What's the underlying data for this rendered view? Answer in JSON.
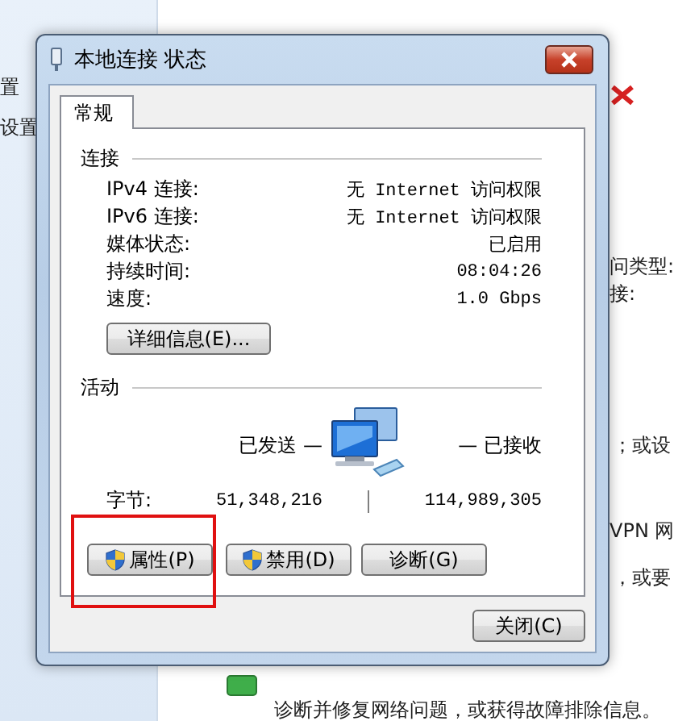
{
  "background": {
    "sidebar_texts": [
      "置",
      "设置"
    ],
    "right_texts": [
      "问类型:",
      "接:",
      "；或设",
      "VPN 网",
      "，或要"
    ],
    "bottom_text": "诊断并修复网络问题，或获得故障排除信息。"
  },
  "dialog": {
    "title": "本地连接 状态",
    "tabs": [
      {
        "label": "常规",
        "selected": true
      }
    ],
    "connection": {
      "heading": "连接",
      "rows": [
        {
          "label": "IPv4 连接:",
          "value": "无 Internet 访问权限"
        },
        {
          "label": "IPv6 连接:",
          "value": "无 Internet 访问权限"
        },
        {
          "label": "媒体状态:",
          "value": "已启用"
        },
        {
          "label": "持续时间:",
          "value": "08:04:26"
        },
        {
          "label": "速度:",
          "value": "1.0 Gbps"
        }
      ],
      "details_button": "详细信息(E)..."
    },
    "activity": {
      "heading": "活动",
      "sent_label": "已发送 —",
      "received_label": "— 已接收",
      "bytes_label": "字节:",
      "sent_bytes": "51,348,216",
      "received_bytes": "114,989,305"
    },
    "buttons": [
      {
        "label": "属性(P)",
        "shield": true,
        "highlighted": true
      },
      {
        "label": "禁用(D)",
        "shield": true,
        "highlighted": false
      },
      {
        "label": "诊断(G)",
        "shield": false,
        "highlighted": false
      }
    ],
    "close_button": "关闭(C)"
  }
}
